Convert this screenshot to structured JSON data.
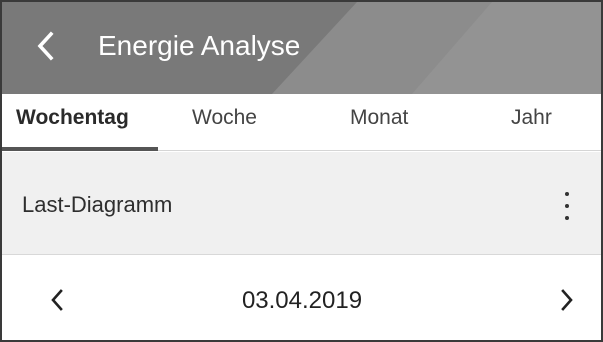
{
  "header": {
    "title": "Energie Analyse",
    "back_icon": "chevron-left-icon",
    "background_color": "#797979"
  },
  "tabs": [
    {
      "label": "Wochentag",
      "active": true
    },
    {
      "label": "Woche",
      "active": false
    },
    {
      "label": "Monat",
      "active": false
    },
    {
      "label": "Jahr",
      "active": false
    }
  ],
  "section": {
    "title": "Last-Diagramm",
    "menu_icon": "more-vertical-icon"
  },
  "date_nav": {
    "date": "03.04.2019",
    "prev_icon": "chevron-left-icon",
    "next_icon": "chevron-right-icon"
  }
}
